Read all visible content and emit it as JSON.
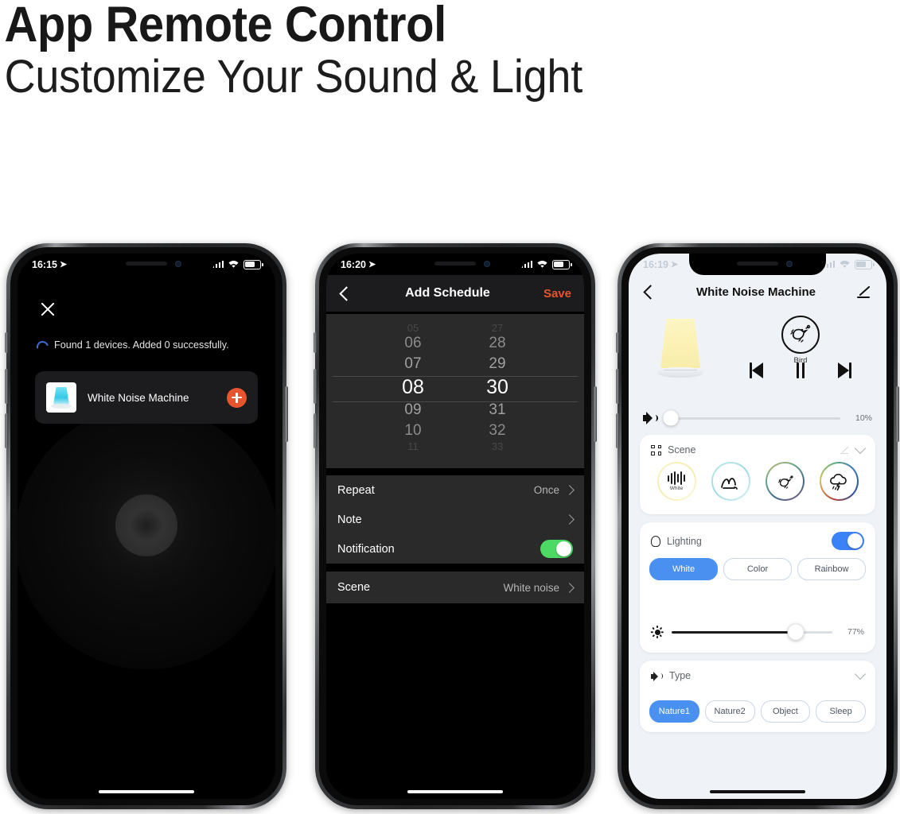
{
  "hero": {
    "title": "App Remote Control",
    "subtitle": "Customize Your Sound & Light"
  },
  "colors": {
    "accent_orange": "#e8542e",
    "accent_blue": "#4a90f0",
    "toggle_green": "#4cd964",
    "screen_light_bg": "#eff2f6",
    "screen_dark_bg": "#000000"
  },
  "phone1": {
    "status": {
      "time": "16:15",
      "location_icon": "location-arrow-icon",
      "signal_icon": "cellular-bars-icon",
      "wifi_icon": "wifi-icon",
      "battery_icon": "battery-icon"
    },
    "close_label": "close-icon",
    "scan_message": "Found 1 devices. Added 0 successfully.",
    "device": {
      "name": "White Noise Machine",
      "thumb_icon": "lamp-thumbnail-icon",
      "add_label": "plus-icon"
    }
  },
  "phone2": {
    "status": {
      "time": "16:20"
    },
    "nav": {
      "back": "chevron-left-icon",
      "title": "Add Schedule",
      "save": "Save"
    },
    "picker": {
      "hours": [
        "05",
        "06",
        "07",
        "08",
        "09",
        "10",
        "11"
      ],
      "minutes": [
        "27",
        "28",
        "29",
        "30",
        "31",
        "32",
        "33"
      ],
      "selected_hour": "08",
      "selected_minute": "30"
    },
    "rows": [
      {
        "label": "Repeat",
        "value": "Once",
        "type": "chevron"
      },
      {
        "label": "Note",
        "value": "",
        "type": "chevron"
      },
      {
        "label": "Notification",
        "value": "",
        "type": "toggle",
        "on": true
      }
    ],
    "scene_row": {
      "label": "Scene",
      "value": "White noise",
      "type": "chevron"
    }
  },
  "phone3": {
    "status": {
      "time": "16:19"
    },
    "nav": {
      "back": "chevron-left-icon",
      "title": "White Noise Machine",
      "edit": "pencil-icon"
    },
    "player": {
      "lamp_icon": "warm-lamp-icon",
      "sound_name": "Bird",
      "sound_icon": "bird-icon",
      "prev_label": "previous-track-icon",
      "pause_label": "pause-icon",
      "next_label": "next-track-icon"
    },
    "volume": {
      "icon": "speaker-icon",
      "percent": "10%",
      "value": 10
    },
    "scene_card": {
      "title": "Scene",
      "grid_icon": "grid-icon",
      "edit_icon": "pencil-icon",
      "collapse_icon": "chevron-down-icon",
      "items": [
        {
          "name": "White",
          "icon": "white-noise-bars-icon",
          "ring": "#f0e3a0",
          "caption": "White"
        },
        {
          "name": "Wave",
          "icon": "wave-icon",
          "ring": "#9fdbe3",
          "caption": ""
        },
        {
          "name": "Bird",
          "icon": "bird-icon",
          "ring": "#7fae8e",
          "caption": ""
        },
        {
          "name": "Thunder",
          "icon": "thunder-cloud-icon",
          "ring": "#b54a3a",
          "caption": ""
        }
      ]
    },
    "lighting_card": {
      "title": "Lighting",
      "bulb_icon": "bulb-icon",
      "toggle_on": true,
      "modes": [
        {
          "label": "White",
          "selected": true
        },
        {
          "label": "Color",
          "selected": false
        },
        {
          "label": "Rainbow",
          "selected": false
        }
      ],
      "brightness": {
        "icon": "sun-icon",
        "percent": "77%",
        "value": 77
      }
    },
    "type_card": {
      "title": "Type",
      "speaker_icon": "speaker-icon",
      "collapse_icon": "chevron-down-icon",
      "options": [
        {
          "label": "Nature1",
          "selected": true
        },
        {
          "label": "Nature2",
          "selected": false
        },
        {
          "label": "Object",
          "selected": false
        },
        {
          "label": "Sleep",
          "selected": false
        }
      ]
    }
  }
}
